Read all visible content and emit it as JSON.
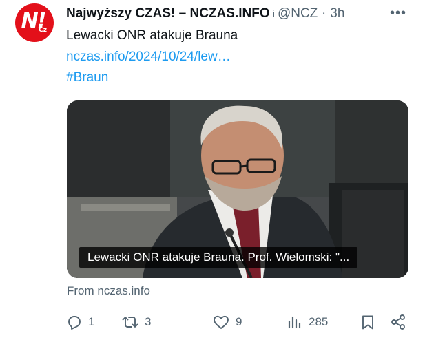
{
  "tweet": {
    "author_name": "Najwyższy CZAS! – NCZAS.INFO",
    "verified_glyph": "i",
    "handle": "@NCZ",
    "separator": "·",
    "time": "3h",
    "more_glyph": "•••",
    "text": "Lewacki ONR atakuje Brauna",
    "link_text": "nczas.info/2024/10/24/lew…",
    "hashtag": "#Braun",
    "media_caption": "Lewacki ONR atakuje Brauna. Prof. Wielomski: \"...",
    "source_text": "From nczas.info"
  },
  "avatar": {
    "text": "N!",
    "sub": "Cz",
    "color": "#e3101a"
  },
  "actions": {
    "reply_count": "1",
    "repost_count": "3",
    "like_count": "9",
    "views_count": "285"
  },
  "colors": {
    "link": "#1d9bf0",
    "muted": "#536471",
    "text": "#0f1419"
  },
  "icons": [
    "reply-icon",
    "repost-icon",
    "like-icon",
    "views-icon",
    "bookmark-icon",
    "share-icon"
  ]
}
